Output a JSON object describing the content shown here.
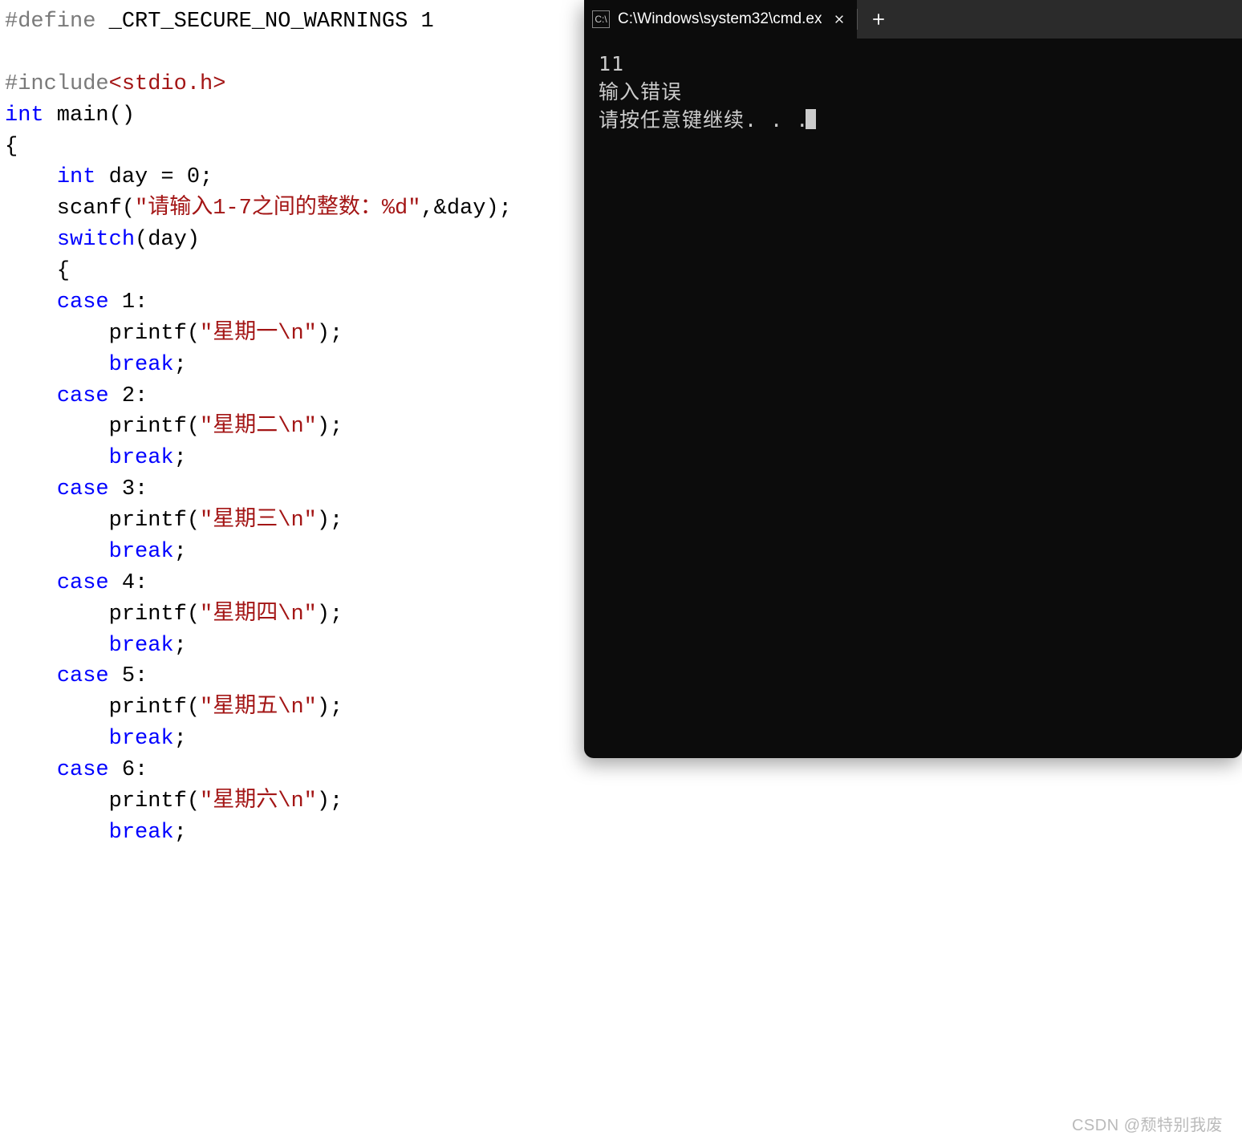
{
  "code": {
    "tokens": [
      [
        {
          "t": "#define",
          "c": "pp"
        },
        {
          "t": " _CRT_SECURE_NO_WARNINGS 1",
          "c": "id"
        }
      ],
      [],
      [
        {
          "t": "#include",
          "c": "pp"
        },
        {
          "t": "<stdio.h>",
          "c": "inc"
        }
      ],
      [
        {
          "t": "int",
          "c": "kw"
        },
        {
          "t": " main()",
          "c": "id"
        }
      ],
      [
        {
          "t": "{",
          "c": "id"
        }
      ],
      [
        {
          "t": "    ",
          "c": "id"
        },
        {
          "t": "int",
          "c": "kw"
        },
        {
          "t": " day = 0;",
          "c": "id"
        }
      ],
      [
        {
          "t": "    scanf(",
          "c": "id"
        },
        {
          "t": "\"请输入1-7之间的整数：%d\"",
          "c": "str"
        },
        {
          "t": ",&day);",
          "c": "id"
        }
      ],
      [
        {
          "t": "    ",
          "c": "id"
        },
        {
          "t": "switch",
          "c": "kw"
        },
        {
          "t": "(day)",
          "c": "id"
        }
      ],
      [
        {
          "t": "    {",
          "c": "id"
        }
      ],
      [
        {
          "t": "    ",
          "c": "id"
        },
        {
          "t": "case",
          "c": "kw"
        },
        {
          "t": " 1:",
          "c": "id"
        }
      ],
      [
        {
          "t": "        printf(",
          "c": "id"
        },
        {
          "t": "\"星期一\\n\"",
          "c": "str"
        },
        {
          "t": ");",
          "c": "id"
        }
      ],
      [
        {
          "t": "        ",
          "c": "id"
        },
        {
          "t": "break",
          "c": "kw"
        },
        {
          "t": ";",
          "c": "id"
        }
      ],
      [
        {
          "t": "    ",
          "c": "id"
        },
        {
          "t": "case",
          "c": "kw"
        },
        {
          "t": " 2:",
          "c": "id"
        }
      ],
      [
        {
          "t": "        printf(",
          "c": "id"
        },
        {
          "t": "\"星期二\\n\"",
          "c": "str"
        },
        {
          "t": ");",
          "c": "id"
        }
      ],
      [
        {
          "t": "        ",
          "c": "id"
        },
        {
          "t": "break",
          "c": "kw"
        },
        {
          "t": ";",
          "c": "id"
        }
      ],
      [
        {
          "t": "    ",
          "c": "id"
        },
        {
          "t": "case",
          "c": "kw"
        },
        {
          "t": " 3:",
          "c": "id"
        }
      ],
      [
        {
          "t": "        printf(",
          "c": "id"
        },
        {
          "t": "\"星期三\\n\"",
          "c": "str"
        },
        {
          "t": ");",
          "c": "id"
        }
      ],
      [
        {
          "t": "        ",
          "c": "id"
        },
        {
          "t": "break",
          "c": "kw"
        },
        {
          "t": ";",
          "c": "id"
        }
      ],
      [
        {
          "t": "    ",
          "c": "id"
        },
        {
          "t": "case",
          "c": "kw"
        },
        {
          "t": " 4:",
          "c": "id"
        }
      ],
      [
        {
          "t": "        printf(",
          "c": "id"
        },
        {
          "t": "\"星期四\\n\"",
          "c": "str"
        },
        {
          "t": ");",
          "c": "id"
        }
      ],
      [
        {
          "t": "        ",
          "c": "id"
        },
        {
          "t": "break",
          "c": "kw"
        },
        {
          "t": ";",
          "c": "id"
        }
      ],
      [
        {
          "t": "    ",
          "c": "id"
        },
        {
          "t": "case",
          "c": "kw"
        },
        {
          "t": " 5:",
          "c": "id"
        }
      ],
      [
        {
          "t": "        printf(",
          "c": "id"
        },
        {
          "t": "\"星期五\\n\"",
          "c": "str"
        },
        {
          "t": ");",
          "c": "id"
        }
      ],
      [
        {
          "t": "        ",
          "c": "id"
        },
        {
          "t": "break",
          "c": "kw"
        },
        {
          "t": ";",
          "c": "id"
        }
      ],
      [
        {
          "t": "    ",
          "c": "id"
        },
        {
          "t": "case",
          "c": "kw"
        },
        {
          "t": " 6:",
          "c": "id"
        }
      ],
      [
        {
          "t": "        printf(",
          "c": "id"
        },
        {
          "t": "\"星期六\\n\"",
          "c": "str"
        },
        {
          "t": ");",
          "c": "id"
        }
      ],
      [
        {
          "t": "        ",
          "c": "id"
        },
        {
          "t": "break",
          "c": "kw"
        },
        {
          "t": ";",
          "c": "id"
        }
      ]
    ]
  },
  "terminal": {
    "tab_title": "C:\\Windows\\system32\\cmd.ex",
    "icon_glyph": "C:\\",
    "output_lines": [
      "11",
      "输入错误",
      "请按任意键继续. . ."
    ]
  },
  "watermark": "CSDN @颓特别我废"
}
